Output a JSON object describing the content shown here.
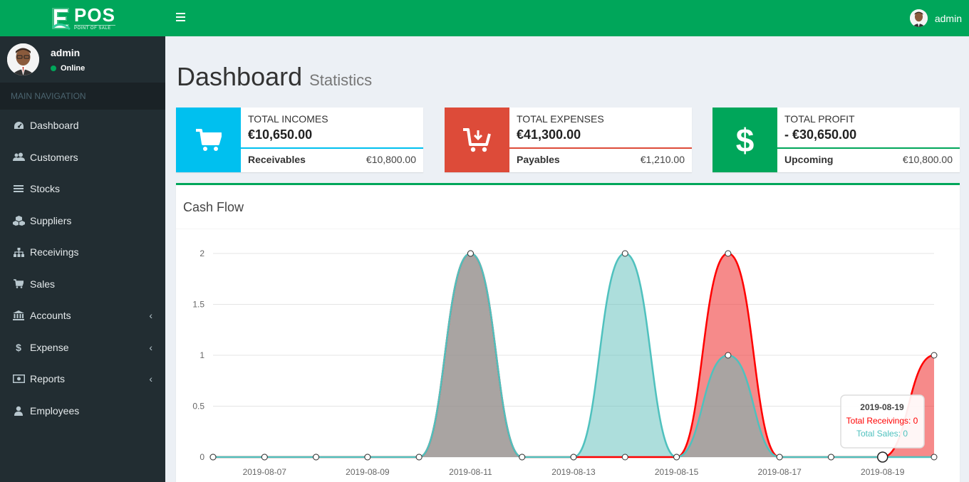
{
  "brand": {
    "title": "POS",
    "subtitle": "POINT OF SALE"
  },
  "user": {
    "name": "admin",
    "status": "Online"
  },
  "sidebar": {
    "header": "MAIN NAVIGATION",
    "items": [
      {
        "label": "Dashboard",
        "icon": "dashboard-icon"
      },
      {
        "label": "Customers",
        "icon": "users-icon"
      },
      {
        "label": "Stocks",
        "icon": "list-icon"
      },
      {
        "label": "Suppliers",
        "icon": "cubes-icon"
      },
      {
        "label": "Receivings",
        "icon": "sitemap-icon"
      },
      {
        "label": "Sales",
        "icon": "cart-icon"
      },
      {
        "label": "Accounts",
        "icon": "bank-icon",
        "has_submenu": true
      },
      {
        "label": "Expense",
        "icon": "dollar-icon",
        "has_submenu": true
      },
      {
        "label": "Reports",
        "icon": "money-icon",
        "has_submenu": true
      },
      {
        "label": "Employees",
        "icon": "user-icon"
      }
    ]
  },
  "page": {
    "title": "Dashboard",
    "subtitle": "Statistics"
  },
  "stats": {
    "incomes": {
      "label": "TOTAL INCOMES",
      "value": "€10,650.00",
      "foot_label": "Receivables",
      "foot_value": "€10,800.00",
      "color": "#00c0ef"
    },
    "expenses": {
      "label": "TOTAL EXPENSES",
      "value": "€41,300.00",
      "foot_label": "Payables",
      "foot_value": "€1,210.00",
      "color": "#dd4b39"
    },
    "profit": {
      "label": "TOTAL PROFIT",
      "value": "- €30,650.00",
      "foot_label": "Upcoming",
      "foot_value": "€10,800.00",
      "color": "#00a65a"
    }
  },
  "cashflow": {
    "title": "Cash Flow"
  },
  "chart_data": {
    "type": "area",
    "x": [
      "2019-08-06",
      "2019-08-07",
      "2019-08-08",
      "2019-08-09",
      "2019-08-10",
      "2019-08-11",
      "2019-08-12",
      "2019-08-13",
      "2019-08-14",
      "2019-08-15",
      "2019-08-16",
      "2019-08-17",
      "2019-08-18",
      "2019-08-19",
      "2019-08-20"
    ],
    "x_tick_labels": [
      "2019-08-07",
      "2019-08-09",
      "2019-08-11",
      "2019-08-13",
      "2019-08-15",
      "2019-08-17",
      "2019-08-19"
    ],
    "y_ticks": [
      "0",
      "0.5",
      "1",
      "1.5",
      "2"
    ],
    "ylim": [
      0,
      2
    ],
    "series": [
      {
        "name": "Total Receivings",
        "color": "#ff0000",
        "values": [
          0,
          0,
          0,
          0,
          0,
          2,
          0,
          0,
          0,
          0,
          2,
          0,
          0,
          0,
          1
        ]
      },
      {
        "name": "Total Sales",
        "color": "#4fc1be",
        "values": [
          0,
          0,
          0,
          0,
          0,
          2,
          0,
          0,
          2,
          0,
          1,
          0,
          0,
          0,
          0
        ]
      }
    ],
    "tooltip": {
      "date": "2019-08-19",
      "receivings_text": "Total Receivings: 0",
      "sales_text": "Total Sales: 0"
    }
  }
}
